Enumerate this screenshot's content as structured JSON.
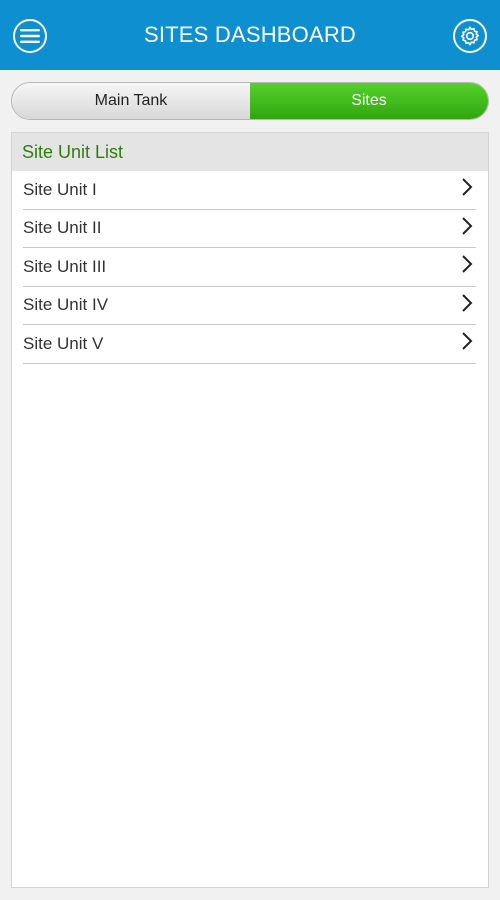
{
  "header": {
    "title": "SITES DASHBOARD",
    "menu_icon": "menu-icon",
    "settings_icon": "gear-icon",
    "background": "#0d8fd0"
  },
  "tabs": [
    {
      "label": "Main Tank",
      "selected": false
    },
    {
      "label": "Sites",
      "selected": true
    }
  ],
  "panel": {
    "title": "Site Unit List",
    "title_color": "#2e7d12",
    "items": [
      {
        "label": "Site Unit I"
      },
      {
        "label": "Site Unit II"
      },
      {
        "label": "Site Unit III"
      },
      {
        "label": "Site Unit IV"
      },
      {
        "label": "Site Unit V"
      }
    ]
  },
  "colors": {
    "accent_green": "#3bb81a"
  }
}
